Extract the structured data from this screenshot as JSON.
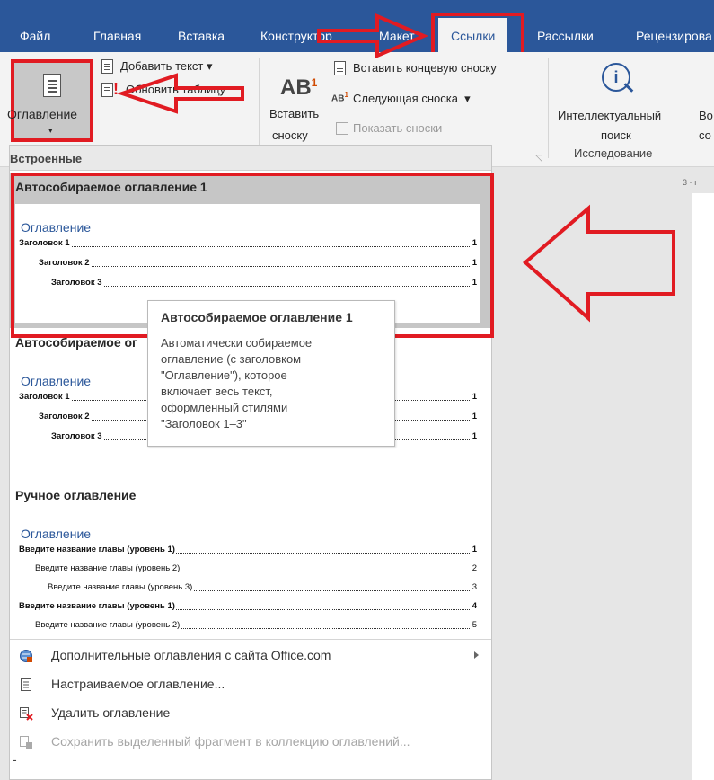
{
  "tabs": {
    "file": "Файл",
    "home": "Главная",
    "insert": "Вставка",
    "design": "Конструктор",
    "layout": "Макет",
    "references": "Ссылки",
    "mailings": "Рассылки",
    "review": "Рецензирова"
  },
  "ribbon": {
    "toc_button": "Оглавление",
    "add_text": "Добавить текст",
    "update_table": "Обновить таблицу",
    "insert_footnote_line1": "Вставить",
    "insert_footnote_line2": "сноску",
    "insert_endnote": "Вставить концевую сноску",
    "next_footnote": "Следующая сноска",
    "show_notes": "Показать сноски",
    "smart_lookup_line1": "Интеллектуальный",
    "smart_lookup_line2": "поиск",
    "research_group": "Исследование",
    "cut_off_line1": "Во",
    "cut_off_line2": "со"
  },
  "gallery": {
    "section_builtin": "Встроенные",
    "auto_toc_1": "Автособираемое оглавление 1",
    "auto_toc_2_partial": "Автособираемое ог",
    "manual_toc": "Ручное оглавление",
    "preview_heading": "Оглавление",
    "heading1": "Заголовок 1",
    "heading2": "Заголовок 2",
    "heading3": "Заголовок 3",
    "page_num": "1",
    "manual_rows": [
      {
        "text": "Введите название главы (уровень 1)",
        "page": "1"
      },
      {
        "text": "Введите название главы (уровень 2)",
        "page": "2"
      },
      {
        "text": "Введите название главы (уровень 3)",
        "page": "3"
      },
      {
        "text": "Введите название главы (уровень 1)",
        "page": "4"
      },
      {
        "text": "Введите название главы (уровень 2)",
        "page": "5"
      }
    ]
  },
  "tooltip": {
    "title": "Автособираемое оглавление 1",
    "body": "Автоматически собираемое\nоглавление (с заголовком\n\"Оглавление\"), которое\nвключает весь текст,\nоформленный стилями\n\"Заголовок 1–3\""
  },
  "menu": {
    "more_tocs": "Дополнительные оглавления с сайта Office.com",
    "custom_toc": "Настраиваемое оглавление...",
    "remove_toc": "Удалить оглавление",
    "save_selection": "Сохранить выделенный фрагмент в коллекцию оглавлений..."
  },
  "ruler_mark": "3 · ı",
  "dash": "-",
  "colors": {
    "ribbon_blue": "#2b579a",
    "highlight_red": "#e11b22"
  }
}
